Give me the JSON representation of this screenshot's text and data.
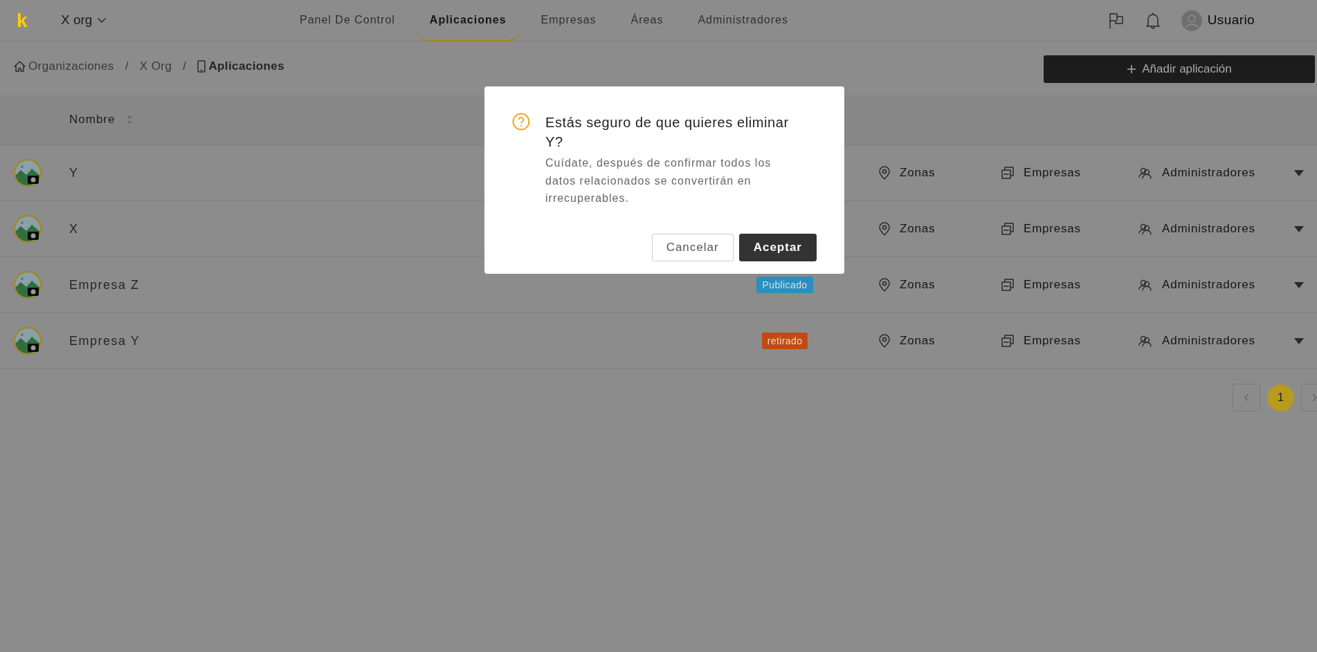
{
  "navbar": {
    "logo": "k",
    "org": "X org",
    "tabs": [
      {
        "label": "Panel De Control",
        "selected": false
      },
      {
        "label": "Aplicaciones",
        "selected": true
      },
      {
        "label": "Empresas",
        "selected": false
      },
      {
        "label": "Áreas",
        "selected": false
      },
      {
        "label": "Administradores",
        "selected": false
      }
    ],
    "user": "Usuario"
  },
  "breadcrumb": {
    "separator": "/",
    "items": [
      {
        "label": "Organizaciones",
        "kind": "home",
        "current": false
      },
      {
        "label": "X Org",
        "kind": "plain",
        "current": false
      },
      {
        "label": "Aplicaciones",
        "kind": "device",
        "current": true
      }
    ]
  },
  "add_button": "Añadir aplicación",
  "table": {
    "columns": [
      {
        "label": "Nombre",
        "sortable": true
      }
    ],
    "rows": [
      {
        "name": "Y",
        "links": [
          "Zonas",
          "Empresas",
          "Administradores"
        ]
      },
      {
        "name": "X",
        "links": [
          "Zonas",
          "Empresas",
          "Administradores"
        ]
      },
      {
        "name": "Empresa Z",
        "status": "Publicado",
        "color": "#2a8fc0",
        "links": [
          "Zonas",
          "Empresas",
          "Administradores"
        ]
      },
      {
        "name": "Empresa Y",
        "status": "retirado",
        "color": "#c24a12",
        "links": [
          "Zonas",
          "Empresas",
          "Administradores"
        ]
      }
    ]
  },
  "pagination": {
    "pages": [
      {
        "label": "1",
        "selected": true
      }
    ]
  },
  "modal": {
    "title": "Estás seguro de que quieres eliminar Y?",
    "message": "Cuídate, después de confirmar todos los datos relacionados se convertirán en irrecuperables.",
    "buttons": [
      {
        "label": "Cancelar",
        "kind": "secondary"
      },
      {
        "label": "Aceptar",
        "kind": "primary"
      }
    ]
  }
}
